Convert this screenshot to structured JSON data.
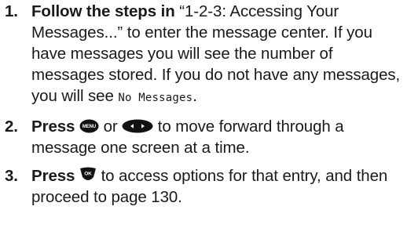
{
  "steps": [
    {
      "number": "1.",
      "lead": "Follow the steps in",
      "quote": "“1-2-3: Accessing Your Messages...”",
      "text_a": " to enter the message center. If you have messages you will see the number of messages stored. If you do not have any messages, you will see ",
      "screen_text": "No Messages",
      "text_b": "."
    },
    {
      "number": "2.",
      "lead": "Press",
      "or": " or ",
      "text": " to move forward through a message one screen at a time.",
      "icons": [
        "menu-key-icon",
        "navigation-key-icon"
      ],
      "menu_key_label": "MENU"
    },
    {
      "number": "3.",
      "lead": "Press",
      "text": " to access options for that entry, and then proceed to page 130.",
      "icons": [
        "ok-key-icon"
      ],
      "ok_key_label": "OK"
    }
  ]
}
